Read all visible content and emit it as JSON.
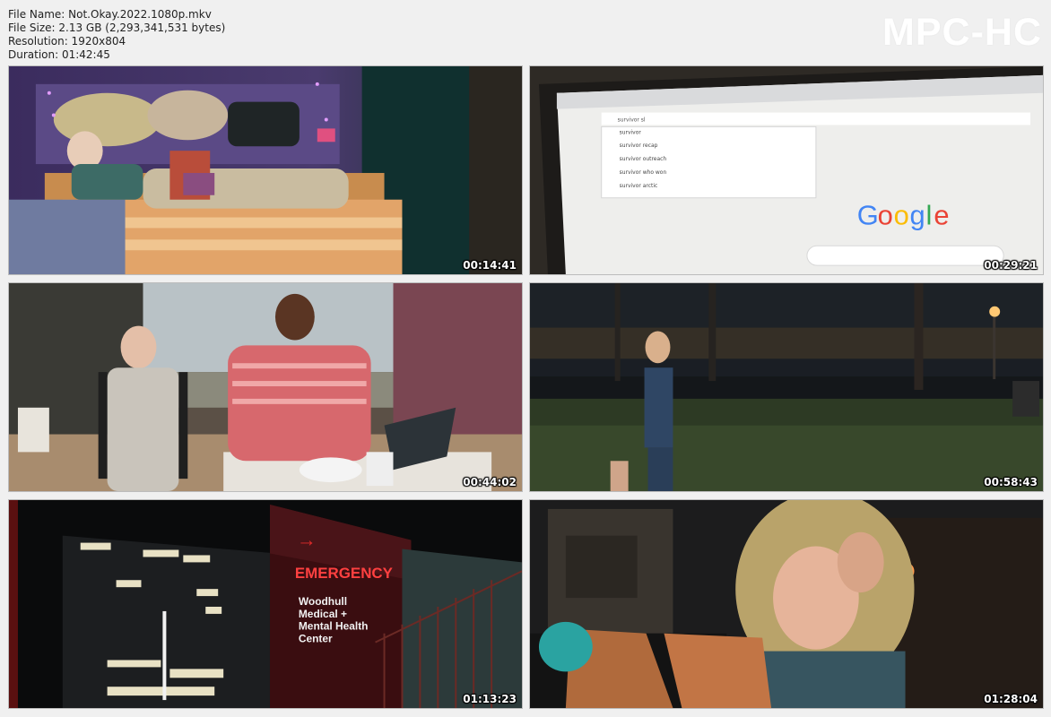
{
  "file_info": {
    "file_name": "File Name: Not.Okay.2022.1080p.mkv",
    "file_size": "File Size: 2.13 GB (2,293,341,531 bytes)",
    "resolution": "Resolution: 1920x804",
    "duration": "Duration: 01:42:45"
  },
  "logo": "MPC-HC",
  "thumbnails": [
    {
      "timestamp": "00:14:41"
    },
    {
      "timestamp": "00:29:21",
      "search_text": "survivor sl",
      "suggestions": [
        "survivor",
        "survivor recap",
        "survivor outreach",
        "survivor who won",
        "survivor arctic"
      ],
      "logo_letters": [
        "G",
        "o",
        "o",
        "g",
        "l",
        "e"
      ]
    },
    {
      "timestamp": "00:44:02"
    },
    {
      "timestamp": "00:58:43"
    },
    {
      "timestamp": "01:13:23",
      "sign_title": "EMERGENCY",
      "sign_lines": [
        "Woodhull",
        "Medical +",
        "Mental Health",
        "Center"
      ]
    },
    {
      "timestamp": "01:28:04"
    }
  ],
  "colors": {
    "google_blue": "#4285F4",
    "google_red": "#EA4335",
    "google_yellow": "#FBBC05",
    "google_green": "#34A853",
    "emergency_red": "#e02a2a"
  }
}
